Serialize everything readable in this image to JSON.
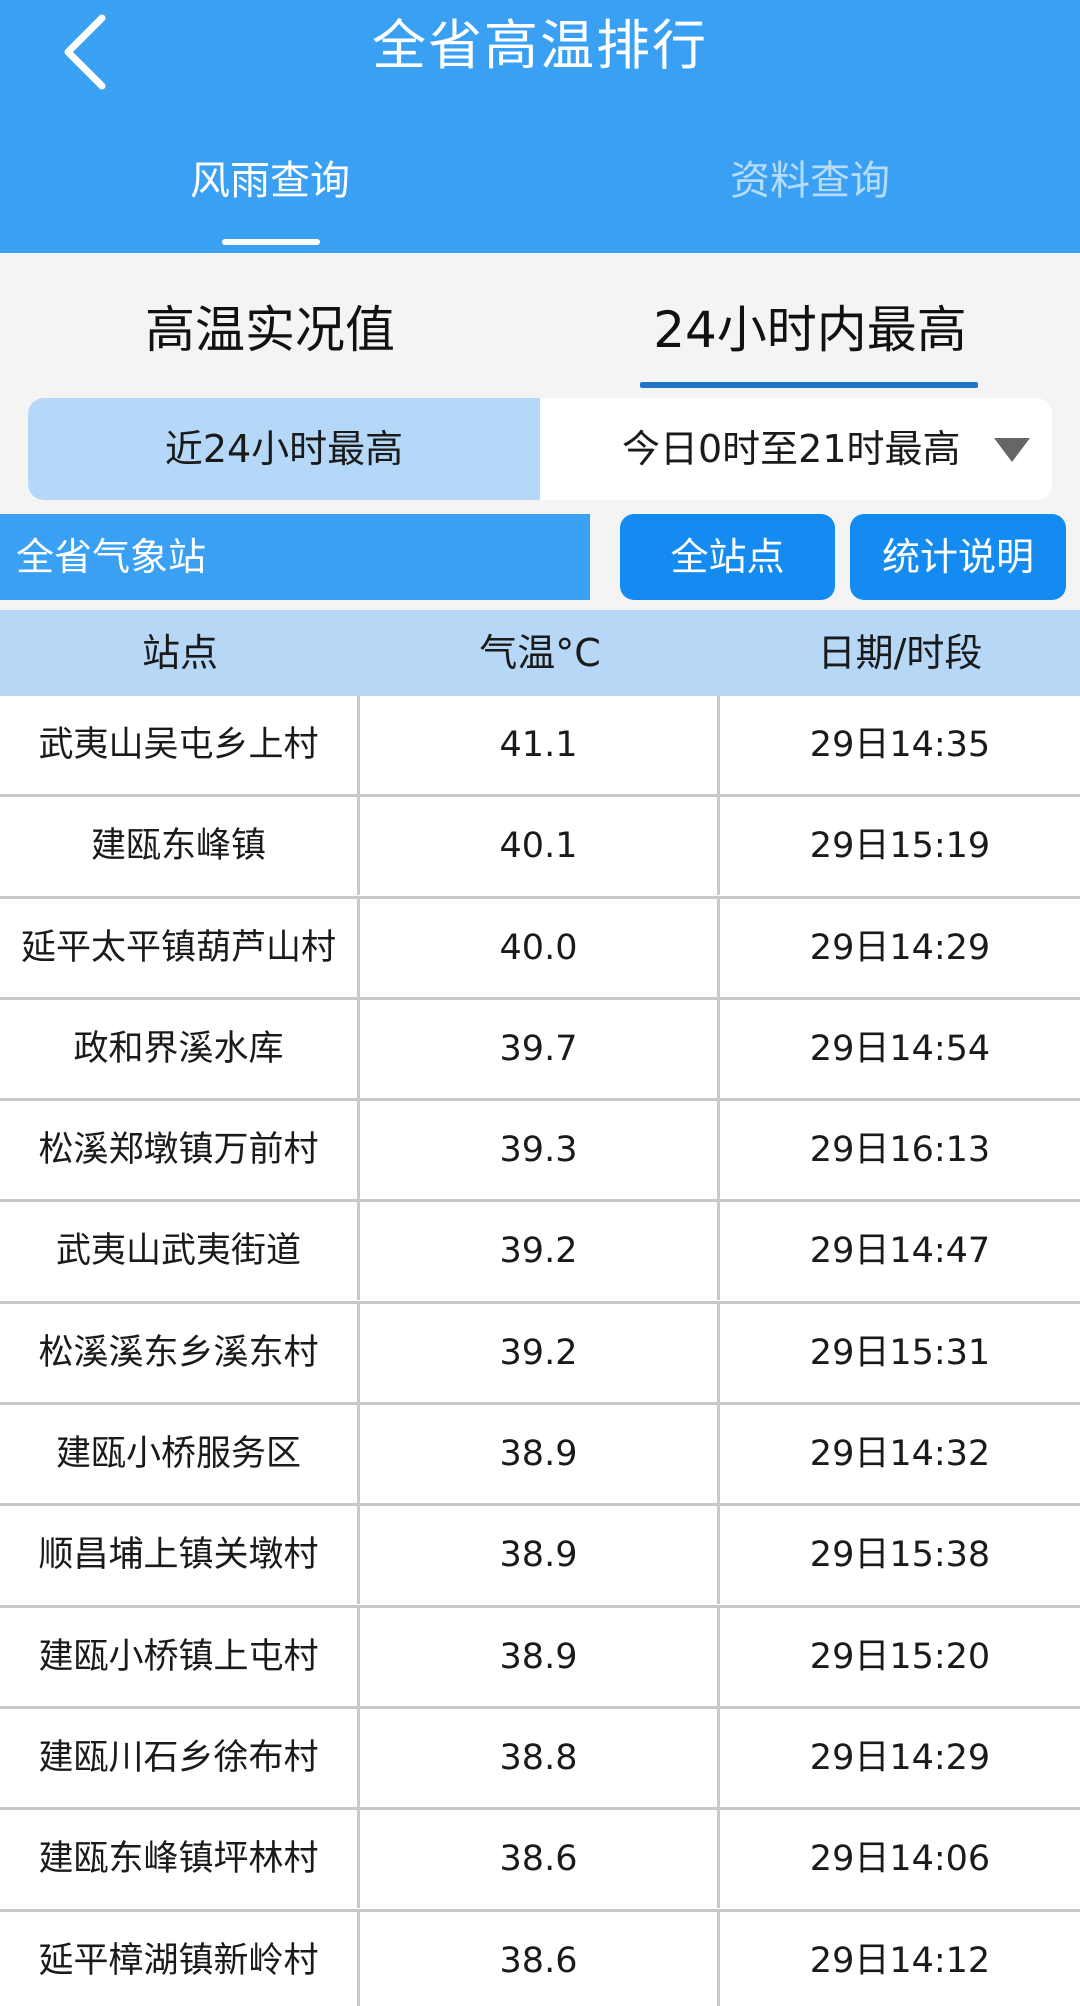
{
  "header": {
    "title": "全省高温排行",
    "tabs": [
      {
        "label": "风雨查询",
        "active": true
      },
      {
        "label": "资料查询",
        "active": false
      }
    ],
    "colors": {
      "background": "#3aa0f4"
    }
  },
  "subtabs": {
    "left": "高温实况值",
    "right": "24小时内最高",
    "active": "right"
  },
  "segment": {
    "left": "近24小时最高",
    "right": "今日0时至21时最高"
  },
  "filter": {
    "station_label": "全省气象站",
    "all_button": "全站点",
    "explain_button": "统计说明"
  },
  "table": {
    "headers": [
      "站点",
      "气温°C",
      "日期/时段"
    ],
    "rows": [
      {
        "station": "武夷山吴屯乡上村",
        "temp": "41.1",
        "time": "29日14:35"
      },
      {
        "station": "建瓯东峰镇",
        "temp": "40.1",
        "time": "29日15:19"
      },
      {
        "station": "延平太平镇葫芦山村",
        "temp": "40.0",
        "time": "29日14:29"
      },
      {
        "station": "政和界溪水库",
        "temp": "39.7",
        "time": "29日14:54"
      },
      {
        "station": "松溪郑墩镇万前村",
        "temp": "39.3",
        "time": "29日16:13"
      },
      {
        "station": "武夷山武夷街道",
        "temp": "39.2",
        "time": "29日14:47"
      },
      {
        "station": "松溪溪东乡溪东村",
        "temp": "39.2",
        "time": "29日15:31"
      },
      {
        "station": "建瓯小桥服务区",
        "temp": "38.9",
        "time": "29日14:32"
      },
      {
        "station": "顺昌埔上镇关墩村",
        "temp": "38.9",
        "time": "29日15:38"
      },
      {
        "station": "建瓯小桥镇上屯村",
        "temp": "38.9",
        "time": "29日15:20"
      },
      {
        "station": "建瓯川石乡徐布村",
        "temp": "38.8",
        "time": "29日14:29"
      },
      {
        "station": "建瓯东峰镇坪林村",
        "temp": "38.6",
        "time": "29日14:06"
      },
      {
        "station": "延平樟湖镇新岭村",
        "temp": "38.6",
        "time": "29日14:12"
      }
    ]
  }
}
